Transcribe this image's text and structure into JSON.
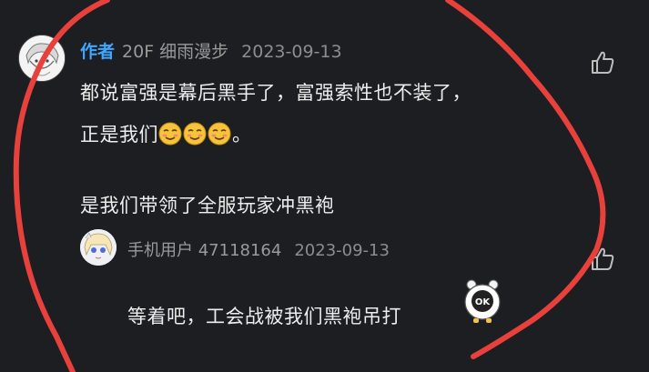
{
  "comment": {
    "author_badge": "作者",
    "floor": "20F",
    "username": "细雨漫步",
    "date": "2023-09-13",
    "line1": "都说富强是幕后黑手了，富强索性也不装了，",
    "line2_prefix": "正是我们",
    "line2_suffix": "。",
    "line3": "是我们带领了全服玩家冲黑袍",
    "emoji_names": [
      "smirk-face-emoji",
      "smirk-face-emoji",
      "smirk-face-emoji"
    ]
  },
  "reply": {
    "username": "手机用户 47118164",
    "date": "2023-09-13",
    "text": "等着吧，工会战被我们黑袍吊打",
    "sticker_label": "OK"
  },
  "icons": {
    "like": "thumbs-up-icon"
  },
  "colors": {
    "background": "#1d1e22",
    "author_badge": "#3fa7ff",
    "annotation": "#e8413c"
  }
}
